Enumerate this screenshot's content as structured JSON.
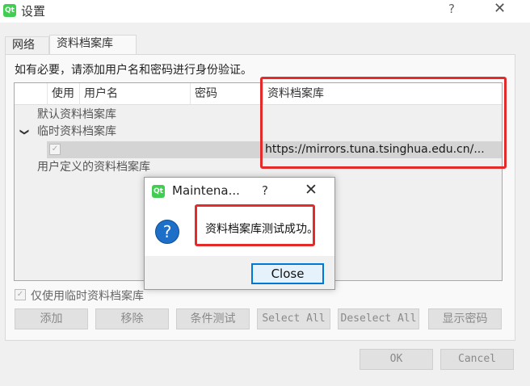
{
  "window": {
    "title": "设置",
    "help_glyph": "?",
    "close_glyph": "✕",
    "logo_text": "Qt"
  },
  "tabs": [
    {
      "label": "网络"
    },
    {
      "label": "资料档案库"
    }
  ],
  "hint": "如有必要，请添加用户名和密码进行身份验证。",
  "table": {
    "headers": [
      "使用",
      "用户名",
      "密码",
      "资料档案库"
    ],
    "rows": {
      "default_repos": "默认资料档案库",
      "temp_repos": "临时资料档案库",
      "expand_arrow": "❯",
      "temp_url": "https://mirrors.tuna.tsinghua.edu.cn/...",
      "user_repos": "用户定义的资料档案库"
    }
  },
  "use_temp_label": "仅使用临时资料档案库",
  "buttons": {
    "add": "添加",
    "remove": "移除",
    "test": "条件测试",
    "select_all": "Select All",
    "deselect_all": "Deselect All",
    "show_password": "显示密码",
    "ok": "OK",
    "cancel": "Cancel"
  },
  "dialog": {
    "title": "Maintena...",
    "help_glyph": "?",
    "close_glyph": "✕",
    "icon_glyph": "?",
    "message": "资料档案库测试成功。",
    "close_button": "Close"
  },
  "colors": {
    "annotation_red": "#e32b2b",
    "accent_blue": "#0078d7",
    "qt_green": "#41cd52"
  },
  "icons": {
    "app_logo": "qt-logo",
    "dialog_icon": "question-icon"
  }
}
